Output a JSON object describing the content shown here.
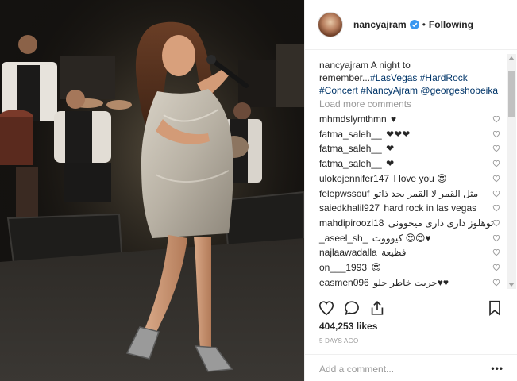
{
  "header": {
    "username": "nancyajram",
    "separator": "•",
    "follow_label": "Following"
  },
  "caption": {
    "username": "nancyajram",
    "text": "A night to remember...",
    "hashtags": "#LasVegas #HardRock #Concert #NancyAjram",
    "mention": "@georgeshobeika"
  },
  "load_more_label": "Load more comments",
  "comments": [
    {
      "user": "mhmdslymthmn",
      "text": "♥"
    },
    {
      "user": "fatma_saleh__",
      "text": "❤❤❤"
    },
    {
      "user": "fatma_saleh__",
      "text": "❤"
    },
    {
      "user": "fatma_saleh__",
      "text": "❤"
    },
    {
      "user": "ulokojennifer147",
      "text": "I love you 😍"
    },
    {
      "user": "felepwssouf",
      "text": "مثل القمر لا القمر بحد ذاتو"
    },
    {
      "user": "saiedkhalil927",
      "text": "hard rock in las vegas"
    },
    {
      "user": "mahdipiroozi18",
      "text": "توهلوز داری داری میخوونی"
    },
    {
      "user": "_aseel_sh_",
      "text": "كيوووت 😍😍♥"
    },
    {
      "user": "najlaawadalla",
      "text": "فظيعة"
    },
    {
      "user": "on___1993",
      "text": "😍"
    },
    {
      "user": "easmen096",
      "text": "جربت خاطر حلو♥♥"
    }
  ],
  "actions": {
    "likes": "404,253 likes",
    "date": "5 DAYS AGO",
    "comment_placeholder": "Add a comment...",
    "more_label": "•••"
  },
  "icons": {
    "verified": "verified-badge-icon",
    "like": "heart-icon",
    "comment": "comment-bubble-icon",
    "share": "share-icon",
    "save": "bookmark-icon"
  },
  "colors": {
    "text": "#262626",
    "secondary": "#999999",
    "hashtag": "#003569",
    "verified": "#3897f0",
    "border": "#efefef"
  }
}
